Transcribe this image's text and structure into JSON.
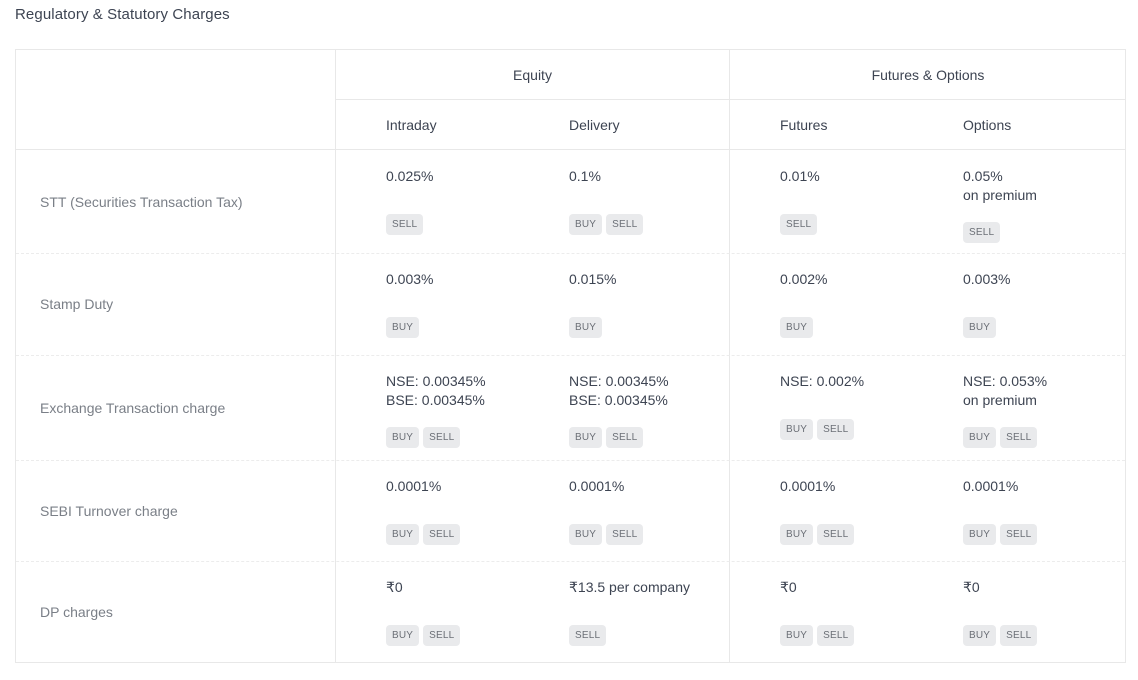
{
  "title": "Regulatory & Statutory Charges",
  "groups": {
    "equity": "Equity",
    "fno": "Futures & Options"
  },
  "columns": [
    "Intraday",
    "Delivery",
    "Futures",
    "Options"
  ],
  "rows": [
    {
      "label": "STT (Securities Transaction Tax)",
      "cells": [
        {
          "lines": [
            "0.025%"
          ],
          "tags": [
            "SELL"
          ]
        },
        {
          "lines": [
            "0.1%"
          ],
          "tags": [
            "BUY",
            "SELL"
          ]
        },
        {
          "lines": [
            "0.01%"
          ],
          "tags": [
            "SELL"
          ]
        },
        {
          "lines": [
            "0.05%",
            "on premium"
          ],
          "tags": [
            "SELL"
          ]
        }
      ]
    },
    {
      "label": "Stamp Duty",
      "cells": [
        {
          "lines": [
            "0.003%"
          ],
          "tags": [
            "BUY"
          ]
        },
        {
          "lines": [
            "0.015%"
          ],
          "tags": [
            "BUY"
          ]
        },
        {
          "lines": [
            "0.002%"
          ],
          "tags": [
            "BUY"
          ]
        },
        {
          "lines": [
            "0.003%"
          ],
          "tags": [
            "BUY"
          ]
        }
      ]
    },
    {
      "label": "Exchange Transaction charge",
      "cells": [
        {
          "lines": [
            "NSE: 0.00345%",
            "BSE: 0.00345%"
          ],
          "tags": [
            "BUY",
            "SELL"
          ]
        },
        {
          "lines": [
            "NSE: 0.00345%",
            "BSE: 0.00345%"
          ],
          "tags": [
            "BUY",
            "SELL"
          ]
        },
        {
          "lines": [
            "NSE: 0.002%"
          ],
          "tags": [
            "BUY",
            "SELL"
          ]
        },
        {
          "lines": [
            "NSE: 0.053%",
            "on premium"
          ],
          "tags": [
            "BUY",
            "SELL"
          ]
        }
      ]
    },
    {
      "label": "SEBI Turnover charge",
      "cells": [
        {
          "lines": [
            "0.0001%"
          ],
          "tags": [
            "BUY",
            "SELL"
          ]
        },
        {
          "lines": [
            "0.0001%"
          ],
          "tags": [
            "BUY",
            "SELL"
          ]
        },
        {
          "lines": [
            "0.0001%"
          ],
          "tags": [
            "BUY",
            "SELL"
          ]
        },
        {
          "lines": [
            "0.0001%"
          ],
          "tags": [
            "BUY",
            "SELL"
          ]
        }
      ]
    },
    {
      "label": "DP charges",
      "cells": [
        {
          "lines": [
            "₹0"
          ],
          "tags": [
            "BUY",
            "SELL"
          ]
        },
        {
          "lines": [
            "₹13.5 per company"
          ],
          "tags": [
            "SELL"
          ]
        },
        {
          "lines": [
            "₹0"
          ],
          "tags": [
            "BUY",
            "SELL"
          ]
        },
        {
          "lines": [
            "₹0"
          ],
          "tags": [
            "BUY",
            "SELL"
          ]
        }
      ]
    }
  ]
}
